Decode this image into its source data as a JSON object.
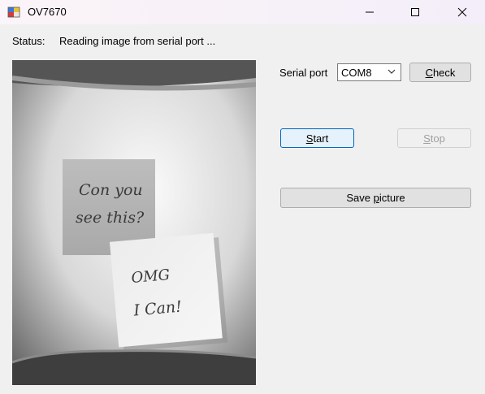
{
  "window": {
    "title": "OV7670"
  },
  "status": {
    "label": "Status:",
    "text": "Reading image from serial port ..."
  },
  "serial": {
    "label": "Serial port",
    "port": "COM8"
  },
  "buttons": {
    "check_first": "C",
    "check_rest": "heck",
    "start_first": "S",
    "start_rest": "tart",
    "stop_first": "S",
    "stop_rest": "top",
    "save_pre": "Save ",
    "save_u": "p",
    "save_post": "icture"
  },
  "image": {
    "note1_line1": "Con you",
    "note1_line2": "see this?",
    "note2_line1": "OMG",
    "note2_line2": "I Can!"
  }
}
